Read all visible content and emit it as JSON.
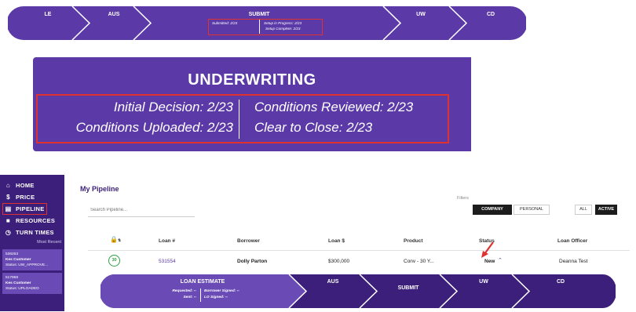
{
  "top_tracker": {
    "steps": [
      "LE",
      "AUS",
      "SUBMIT",
      "UW",
      "CD"
    ],
    "submit_lines": [
      "Submitted: 2/23",
      "Setup in Progress: 2/23",
      "Setup Complete: 2/23"
    ]
  },
  "underwriting_panel": {
    "title": "UNDERWRITING",
    "initial_decision": "Initial Decision: 2/23",
    "conditions_uploaded": "Conditions Uploaded: 2/23",
    "conditions_reviewed": "Conditions Reviewed: 2/23",
    "clear_to_close": "Clear to Close: 2/23"
  },
  "sidebar": {
    "items": [
      {
        "icon": "home-icon",
        "glyph": "⌂",
        "label": "HOME"
      },
      {
        "icon": "dollar-icon",
        "glyph": "$",
        "label": "PRICE"
      },
      {
        "icon": "pipeline-icon",
        "glyph": "▤",
        "label": "PIPELINE"
      },
      {
        "icon": "folder-icon",
        "glyph": "■",
        "label": "RESOURCES"
      },
      {
        "icon": "clock-icon",
        "glyph": "◷",
        "label": "TURN TIMES"
      }
    ],
    "most_recent": "Most Recent",
    "recent": [
      {
        "number": "536253",
        "name": "Kes Customer",
        "status": "Status: UW_APPROVE..."
      },
      {
        "number": "517958",
        "name": "Kes Customer",
        "status": "Status: UPLOADED"
      }
    ]
  },
  "pipeline": {
    "title": "My Pipeline",
    "search_placeholder": "Search Pipeline...",
    "filters_label": "Filters",
    "filter_company": "COMPANY",
    "filter_personal": "PERSONAL",
    "filter_all": "ALL",
    "filter_active": "ACTIVE",
    "columns": [
      "Loan #",
      "Borrower",
      "Loan $",
      "Product",
      "Status",
      "Loan Officer"
    ],
    "row": {
      "badge": "30",
      "loan_number": "531554",
      "borrower": "Dolly Parton",
      "amount": "$300,000",
      "product": "Conv - 30 Y...",
      "status": "New",
      "officer": "Deanna Test"
    },
    "tracker": {
      "loan_estimate": "LOAN ESTIMATE",
      "requested": "Requested: --",
      "sent": "Sent: --",
      "borrower_signed": "Borrower Signed: --",
      "lo_signed": "LO Signed: --",
      "steps": [
        "AUS",
        "SUBMIT",
        "UW",
        "CD"
      ]
    }
  },
  "colors": {
    "purple": "#5b3aa8",
    "dark_purple": "#3b1f7a",
    "highlight": "#e03131",
    "active_dark": "#1c1c1c"
  }
}
